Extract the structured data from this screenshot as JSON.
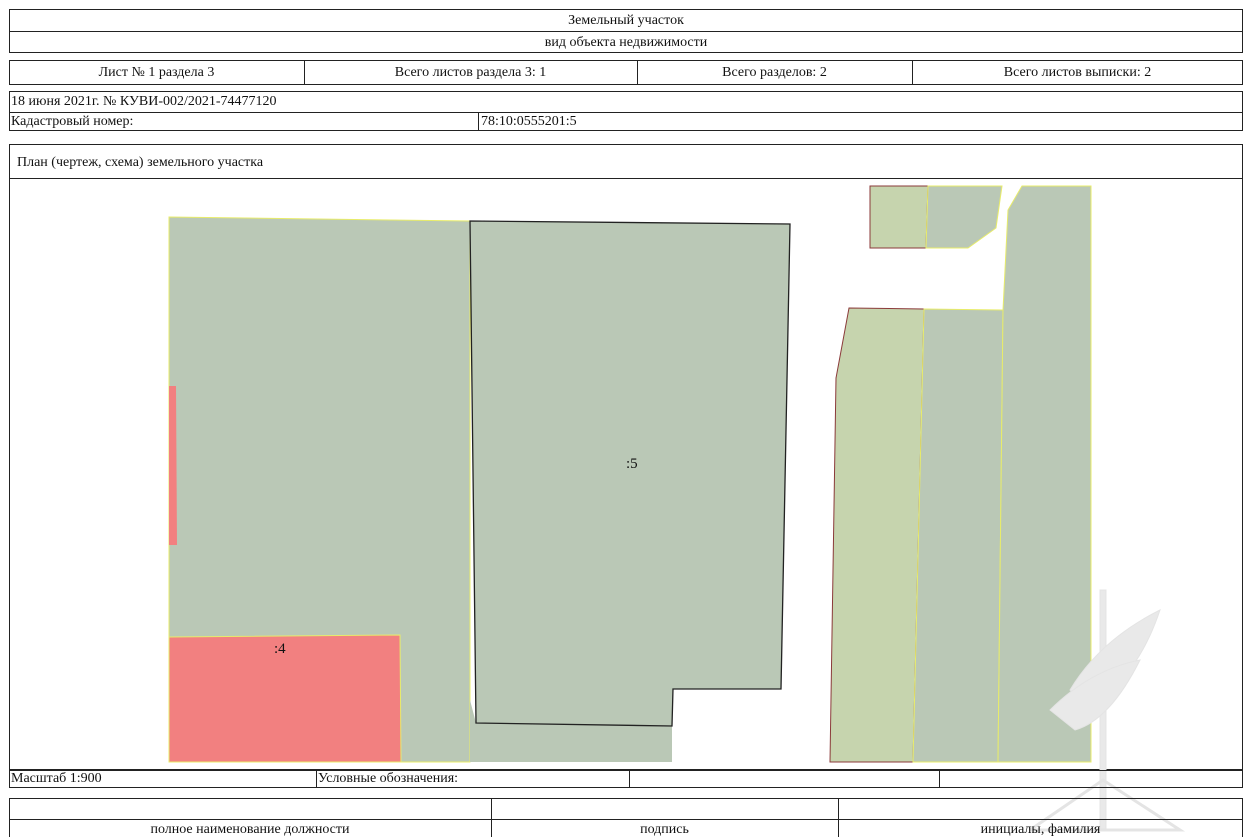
{
  "header": {
    "title": "Земельный участок",
    "subtitle": "вид объекта недвижимости"
  },
  "sheet_info": {
    "sheet": "Лист № 1 раздела 3",
    "sheets_in_section": "Всего листов раздела 3: 1",
    "total_sections": "Всего разделов: 2",
    "total_sheets": "Всего листов выписки: 2"
  },
  "extract_line": "18 июня 2021г. № КУВИ-002/2021-74477120",
  "cadastral": {
    "label": "Кадастровый номер:",
    "value": "78:10:0555201:5"
  },
  "plan": {
    "title": "План (чертеж, схема) земельного участка",
    "labels": {
      "parcel_5": ":5",
      "parcel_4": ":4"
    },
    "colors": {
      "parcel_fill": "#bac8b6",
      "parcel_green": "#c6d4ae",
      "parcel_red": "#f28080",
      "outline_dark": "#222222",
      "outline_yellow": "#e8ec6a",
      "outline_brown": "#8b3a3a"
    }
  },
  "footer": {
    "scale": "Масштаб 1:900",
    "legend_label": "Условные обозначения:"
  },
  "signature": {
    "position": "полное наименование должности",
    "signature": "подпись",
    "name": "инициалы, фамилия"
  },
  "watermark": {
    "icon": "angel-emblem-icon"
  }
}
